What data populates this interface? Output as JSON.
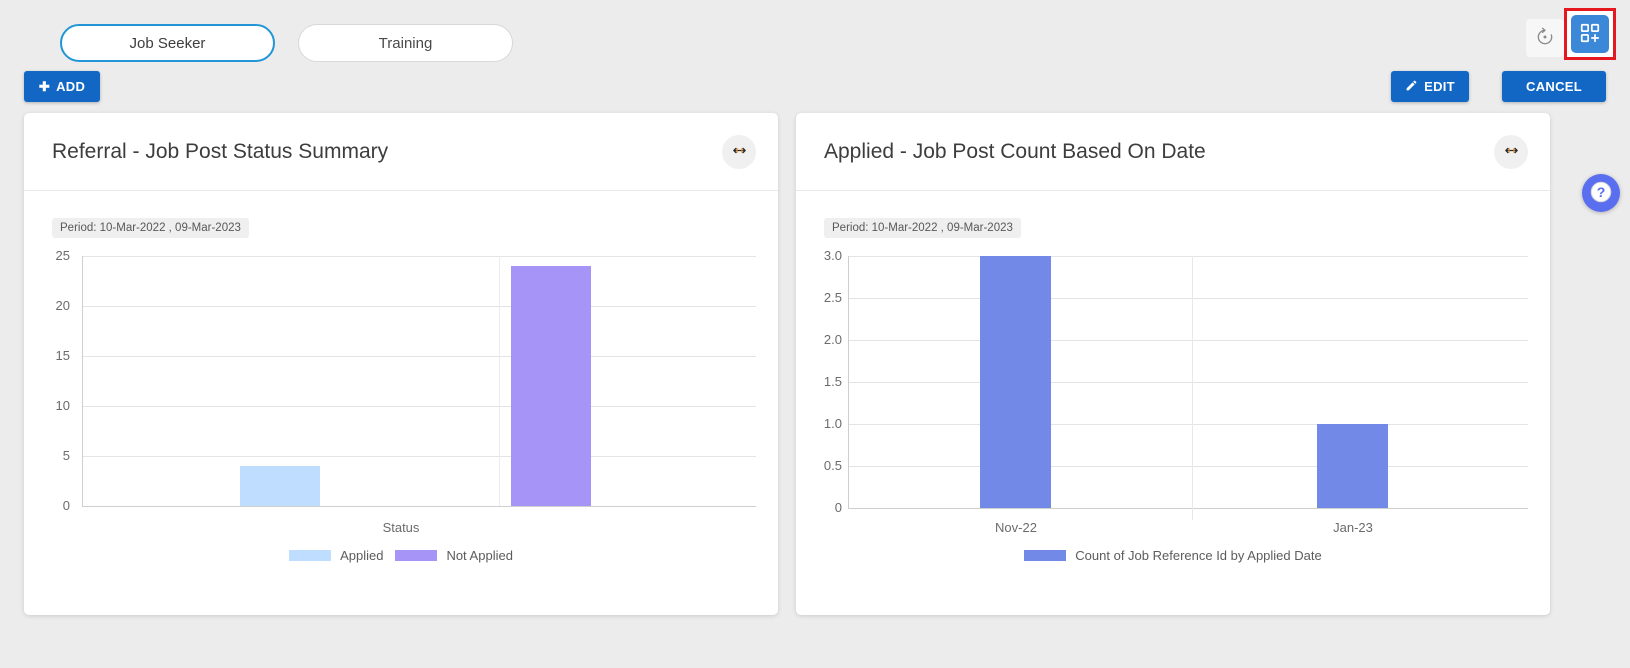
{
  "topbar": {
    "tabs": [
      {
        "label": "Job Seeker",
        "active": true
      },
      {
        "label": "Training",
        "active": false
      }
    ],
    "add_label": "ADD",
    "edit_label": "EDIT",
    "cancel_label": "CANCEL",
    "reset_icon": "reset-icon",
    "add_widget_icon": "add-widget-icon",
    "accent_blue": "#1267c4",
    "selection_red": "#e4181f"
  },
  "help": {
    "icon": "help-icon"
  },
  "cards": [
    {
      "title": "Referral - Job Post Status Summary",
      "resize_icon": "resize-horizontal-icon",
      "period": "Period: 10-Mar-2022 , 09-Mar-2023"
    },
    {
      "title": "Applied - Job Post Count Based On Date",
      "resize_icon": "resize-horizontal-icon",
      "period": "Period: 10-Mar-2022 , 09-Mar-2023"
    }
  ],
  "chart_data": [
    {
      "type": "bar",
      "title": "Referral - Job Post Status Summary",
      "categories": [
        "Applied",
        "Not Applied"
      ],
      "values": [
        4,
        24
      ],
      "colors": [
        "#bfdeff",
        "#a794f7"
      ],
      "xlabel": "Status",
      "ylabel": "",
      "ylim": [
        0,
        25
      ],
      "yticks": [
        "0",
        "5",
        "10",
        "15",
        "20",
        "25"
      ],
      "ytick_values": [
        0,
        5,
        10,
        15,
        20,
        25
      ],
      "xticks": [],
      "legend": [
        "Applied",
        "Not Applied"
      ],
      "legend_position": "bottom",
      "grid": true
    },
    {
      "type": "bar",
      "title": "Applied - Job Post Count Based On Date",
      "categories": [
        "Nov-22",
        "Jan-23"
      ],
      "values": [
        3,
        1
      ],
      "colors": [
        "#7289e8",
        "#7289e8"
      ],
      "xlabel": "",
      "ylabel": "",
      "ylim": [
        0,
        3
      ],
      "yticks": [
        "0",
        "0.5",
        "1.0",
        "1.5",
        "2.0",
        "2.5",
        "3.0"
      ],
      "ytick_values": [
        0,
        0.5,
        1.0,
        1.5,
        2.0,
        2.5,
        3.0
      ],
      "xticks": [
        "Nov-22",
        "Jan-23"
      ],
      "legend": [
        "Count of Job Reference Id by Applied Date"
      ],
      "legend_position": "bottom",
      "grid": true
    }
  ]
}
